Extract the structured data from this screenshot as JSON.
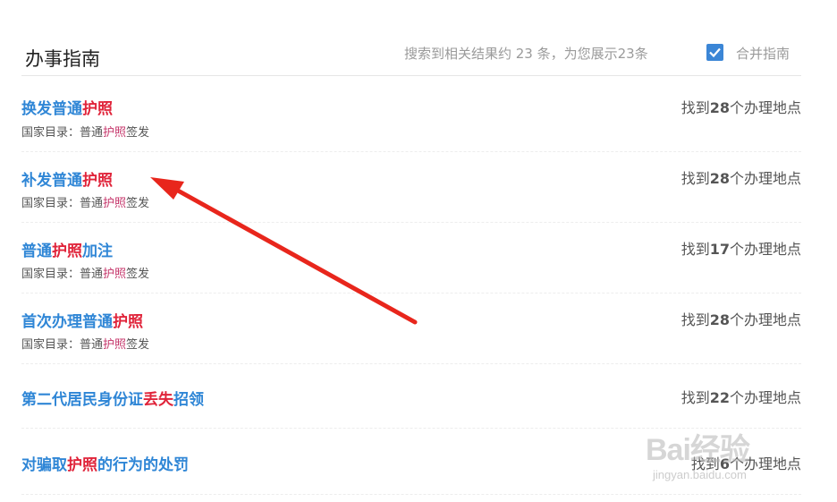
{
  "header": {
    "title": "办事指南",
    "summary": "搜索到相关结果约 23 条，为您展示23条",
    "merge_checked": true,
    "merge_label": "合并指南"
  },
  "results": [
    {
      "title_parts": [
        "换发普通",
        "护照",
        ""
      ],
      "category": {
        "prefix": "国家目录：普通",
        "highlight": "护照",
        "suffix": "签发"
      },
      "count_prefix": "找到",
      "count": "28",
      "count_suffix": "个办理地点"
    },
    {
      "title_parts": [
        "补发普通",
        "护照",
        ""
      ],
      "category": {
        "prefix": "国家目录：普通",
        "highlight": "护照",
        "suffix": "签发"
      },
      "count_prefix": "找到",
      "count": "28",
      "count_suffix": "个办理地点"
    },
    {
      "title_parts": [
        "普通",
        "护照",
        "加注"
      ],
      "category": {
        "prefix": "国家目录：普通",
        "highlight": "护照",
        "suffix": "签发"
      },
      "count_prefix": "找到",
      "count": "17",
      "count_suffix": "个办理地点"
    },
    {
      "title_parts": [
        "首次办理普通",
        "护照",
        ""
      ],
      "category": {
        "prefix": "国家目录：普通",
        "highlight": "护照",
        "suffix": "签发"
      },
      "count_prefix": "找到",
      "count": "28",
      "count_suffix": "个办理地点"
    },
    {
      "title_parts": [
        "第二代居民身份证",
        "丢失",
        "招领"
      ],
      "count_prefix": "找到",
      "count": "22",
      "count_suffix": "个办理地点"
    },
    {
      "title_parts": [
        "对骗取",
        "护照",
        "的行为的处罚"
      ],
      "count_prefix": "找到",
      "count": "6",
      "count_suffix": "个办理地点"
    }
  ],
  "annotation": {
    "arrow_color": "#e8261c"
  },
  "watermark": {
    "logo": "Bai经验",
    "url": "jingyan.baidu.com"
  },
  "colors": {
    "link": "#2f86d6",
    "highlight": "#e0243a",
    "checkbox": "#3b86d6"
  }
}
